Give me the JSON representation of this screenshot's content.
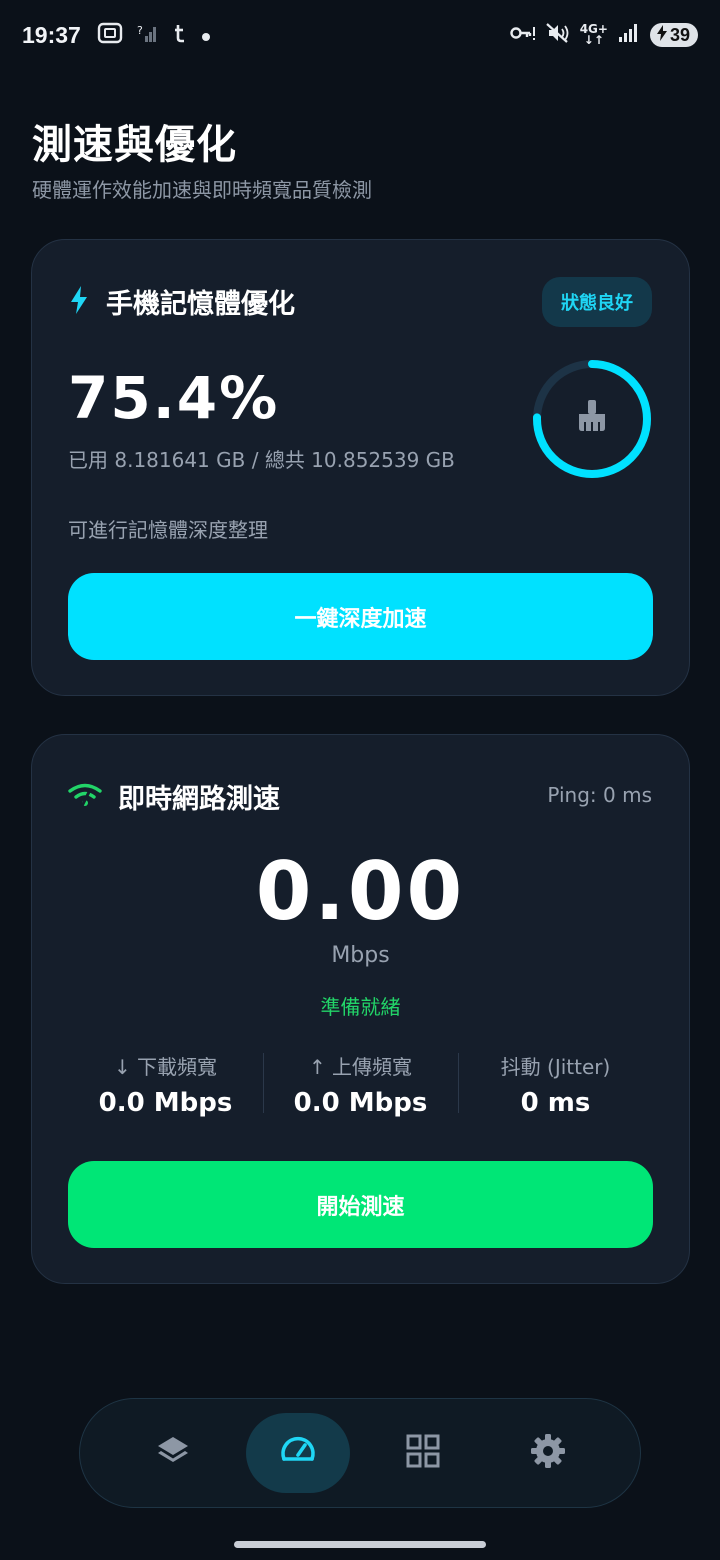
{
  "status_bar": {
    "time": "19:37",
    "left_icons": [
      "screenshot-icon",
      "no-signal-icon",
      "t-app-icon",
      "dot-icon"
    ],
    "network_label_top": "4G+",
    "network_label_bottom": "↓↑",
    "battery_level": "39",
    "right_icons": [
      "vpn-key-icon",
      "mute-icon",
      "signal-icon",
      "battery-charging-icon"
    ]
  },
  "header": {
    "title": "測速與優化",
    "subtitle": "硬體運作效能加速與即時頻寬品質檢測"
  },
  "memory_card": {
    "title": "手機記憶體優化",
    "title_icon": "bolt-icon",
    "badge": "狀態良好",
    "percent": "75.4%",
    "percent_value": 75.4,
    "usage_text": "已用 8.181641 GB / 總共 10.852539 GB",
    "hint": "可進行記憶體深度整理",
    "ring_icon": "broom-icon",
    "button_label": "一鍵深度加速"
  },
  "speed_card": {
    "title": "即時網路測速",
    "title_icon": "wifi-signal-icon",
    "ping": "Ping: 0 ms",
    "speed_value": "0.00",
    "speed_unit": "Mbps",
    "status": "準備就緒",
    "stats": [
      {
        "label": "↓ 下載頻寬",
        "value": "0.0 Mbps"
      },
      {
        "label": "↑ 上傳頻寬",
        "value": "0.0 Mbps"
      },
      {
        "label": "抖動 (Jitter)",
        "value": "0 ms"
      }
    ],
    "button_label": "開始測速"
  },
  "bottom_nav": {
    "items": [
      {
        "icon": "layers-icon",
        "active": false
      },
      {
        "icon": "speedometer-icon",
        "active": true
      },
      {
        "icon": "grid-icon",
        "active": false
      },
      {
        "icon": "gear-icon",
        "active": false
      }
    ]
  },
  "colors": {
    "background": "#0b1119",
    "card": "#151e2b",
    "accent_cyan": "#00e1ff",
    "accent_green": "#00e676",
    "badge_text": "#1fd6f5",
    "muted_text": "#98a2b0"
  }
}
